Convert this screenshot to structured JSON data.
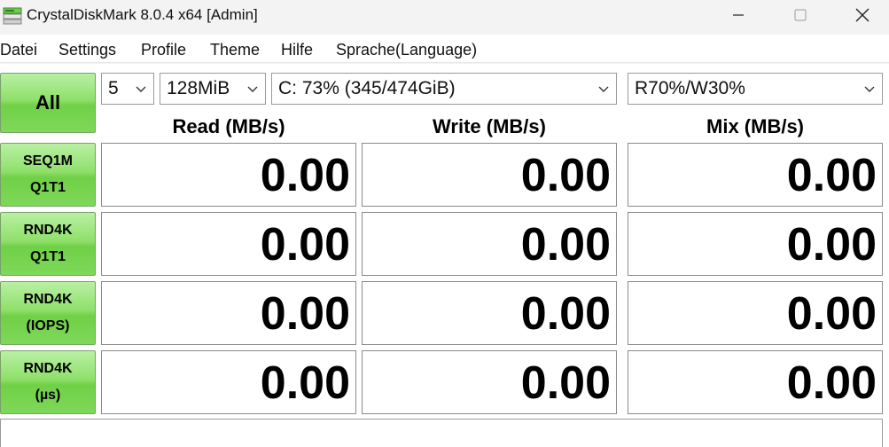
{
  "window": {
    "title": "CrystalDiskMark 8.0.4 x64 [Admin]"
  },
  "menu": [
    "Datei",
    "Settings",
    "Profile",
    "Theme",
    "Hilfe",
    "Sprache(Language)"
  ],
  "controls": {
    "all_label": "All",
    "count": "5",
    "size": "128MiB",
    "drive": "C: 73% (345/474GiB)",
    "mix": "R70%/W30%"
  },
  "headers": {
    "read": "Read (MB/s)",
    "write": "Write (MB/s)",
    "mix": "Mix (MB/s)"
  },
  "tests": [
    {
      "line1": "SEQ1M",
      "line2": "Q1T1",
      "read": "0.00",
      "write": "0.00",
      "mix": "0.00"
    },
    {
      "line1": "RND4K",
      "line2": "Q1T1",
      "read": "0.00",
      "write": "0.00",
      "mix": "0.00"
    },
    {
      "line1": "RND4K",
      "line2": "(IOPS)",
      "read": "0.00",
      "write": "0.00",
      "mix": "0.00"
    },
    {
      "line1": "RND4K",
      "line2": "(µs)",
      "read": "0.00",
      "write": "0.00",
      "mix": "0.00"
    }
  ],
  "comment": "",
  "colors": {
    "button_green": "#7fd85a",
    "window_bg": "#f3f3f3"
  },
  "icons": [
    "crystaldiskmark-app-icon",
    "minimize-icon",
    "maximize-icon",
    "close-icon",
    "chevron-down-icon"
  ]
}
